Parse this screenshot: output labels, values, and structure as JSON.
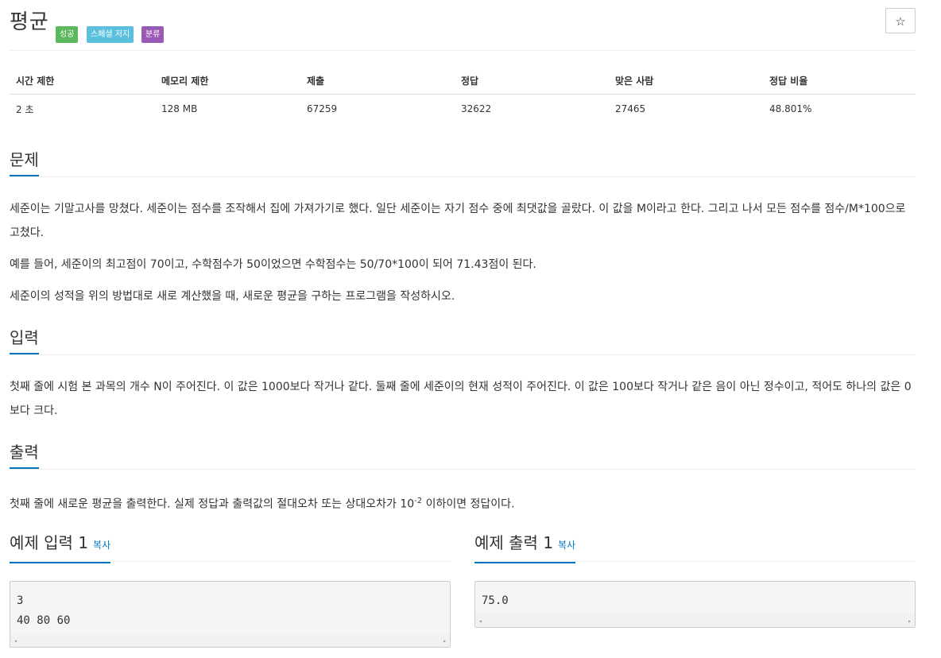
{
  "problem": {
    "title": "평균",
    "badges": {
      "success": "성공",
      "special": "스페셜 저지",
      "tag": "분류"
    },
    "star": "☆"
  },
  "info_table": {
    "headers": [
      "시간 제한",
      "메모리 제한",
      "제출",
      "정답",
      "맞은 사람",
      "정답 비율"
    ],
    "values": [
      "2 초",
      "128 MB",
      "67259",
      "32622",
      "27465",
      "48.801%"
    ]
  },
  "sections": {
    "description": {
      "heading": "문제",
      "paragraphs": [
        "세준이는 기말고사를 망쳤다. 세준이는 점수를 조작해서 집에 가져가기로 했다. 일단 세준이는 자기 점수 중에 최댓값을 골랐다. 이 값을 M이라고 한다. 그리고 나서 모든 점수를 점수/M*100으로 고쳤다.",
        "예를 들어, 세준이의 최고점이 70이고, 수학점수가 50이었으면 수학점수는 50/70*100이 되어 71.43점이 된다.",
        "세준이의 성적을 위의 방법대로 새로 계산했을 때, 새로운 평균을 구하는 프로그램을 작성하시오."
      ]
    },
    "input": {
      "heading": "입력",
      "paragraph": "첫째 줄에 시험 본 과목의 개수 N이 주어진다. 이 값은 1000보다 작거나 같다. 둘째 줄에 세준이의 현재 성적이 주어진다. 이 값은 100보다 작거나 같은 음이 아닌 정수이고, 적어도 하나의 값은 0보다 크다."
    },
    "output": {
      "heading": "출력",
      "text_before": "첫째 줄에 새로운 평균을 출력한다. 실제 정답과 출력값의 절대오차 또는 상대오차가 10",
      "exponent": "-2",
      "text_after": " 이하이면 정답이다."
    }
  },
  "samples": {
    "input": {
      "heading": "예제 입력 1",
      "copy": "복사",
      "lines": [
        "3",
        "40 80 60"
      ]
    },
    "output": {
      "heading": "예제 출력 1",
      "copy": "복사",
      "lines": [
        "75.0"
      ]
    }
  },
  "scroll_arrows": {
    "left": "◂",
    "right": "▸"
  }
}
